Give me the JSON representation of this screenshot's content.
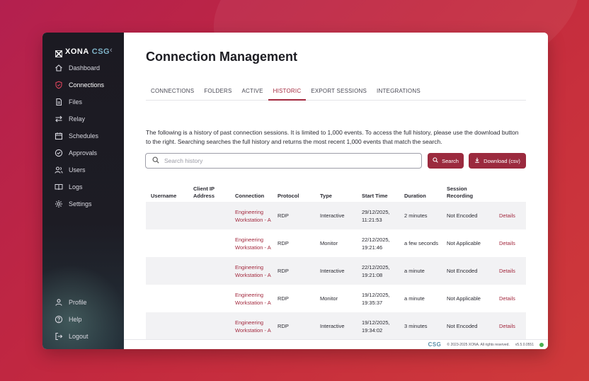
{
  "brand": {
    "name": "XONA",
    "accent": "CSG",
    "collapse_glyph": "‹"
  },
  "sidebar": {
    "items": [
      {
        "label": "Dashboard",
        "icon": "home-icon"
      },
      {
        "label": "Connections",
        "icon": "shield-icon"
      },
      {
        "label": "Files",
        "icon": "file-icon"
      },
      {
        "label": "Relay",
        "icon": "relay-arrows-icon"
      },
      {
        "label": "Schedules",
        "icon": "calendar-icon"
      },
      {
        "label": "Approvals",
        "icon": "check-circle-icon"
      },
      {
        "label": "Users",
        "icon": "users-icon"
      },
      {
        "label": "Logs",
        "icon": "book-icon"
      },
      {
        "label": "Settings",
        "icon": "gear-icon"
      }
    ],
    "bottom_items": [
      {
        "label": "Profile",
        "icon": "person-icon"
      },
      {
        "label": "Help",
        "icon": "help-icon"
      },
      {
        "label": "Logout",
        "icon": "logout-icon"
      }
    ],
    "active": "Connections"
  },
  "page": {
    "title": "Connection Management"
  },
  "tabs": [
    {
      "label": "CONNECTIONS"
    },
    {
      "label": "FOLDERS"
    },
    {
      "label": "ACTIVE"
    },
    {
      "label": "HISTORIC"
    },
    {
      "label": "EXPORT SESSIONS"
    },
    {
      "label": "INTEGRATIONS"
    }
  ],
  "active_tab": "HISTORIC",
  "description": "The following is a history of past connection sessions. It is limited to 1,000 events. To access the full history, please use the download button to the right. Searching searches the full history and returns the most recent 1,000 events that match the search.",
  "search": {
    "placeholder": "Search history",
    "value": "",
    "button_label": "Search"
  },
  "download": {
    "label": "Download (csv)"
  },
  "table": {
    "columns": [
      "Username",
      "Client IP Address",
      "Connection",
      "Protocol",
      "Type",
      "Start Time",
      "Duration",
      "Session Recording",
      ""
    ],
    "rows": [
      {
        "username": "",
        "client_ip": "",
        "connection": "Engineering Workstation - A",
        "protocol": "RDP",
        "type": "Interactive",
        "start_time": "29/12/2025, 11:21:53",
        "duration": "2 minutes",
        "recording": "Not Encoded",
        "action": "Details"
      },
      {
        "username": "",
        "client_ip": "",
        "connection": "Engineering Workstation - A",
        "protocol": "RDP",
        "type": "Monitor",
        "start_time": "22/12/2025, 19:21:46",
        "duration": "a few seconds",
        "recording": "Not Applicable",
        "action": "Details"
      },
      {
        "username": "",
        "client_ip": "",
        "connection": "Engineering Workstation - A",
        "protocol": "RDP",
        "type": "Interactive",
        "start_time": "22/12/2025, 19:21:08",
        "duration": "a minute",
        "recording": "Not Encoded",
        "action": "Details"
      },
      {
        "username": "",
        "client_ip": "",
        "connection": "Engineering Workstation - A",
        "protocol": "RDP",
        "type": "Monitor",
        "start_time": "19/12/2025, 19:35:37",
        "duration": "a minute",
        "recording": "Not Applicable",
        "action": "Details"
      },
      {
        "username": "",
        "client_ip": "",
        "connection": "Engineering Workstation - A",
        "protocol": "RDP",
        "type": "Interactive",
        "start_time": "19/12/2025, 19:34:02",
        "duration": "3 minutes",
        "recording": "Not Encoded",
        "action": "Details"
      }
    ]
  },
  "footer": {
    "logo": "CSG",
    "copyright": "© 2023-2025 XONA. All rights reserved.",
    "version": "v5.5.0.0551"
  },
  "colors": {
    "accent": "#a3293e",
    "button": "#9b2a3e",
    "sidebar": "#1b1a22",
    "status_ok": "#4caf50"
  }
}
